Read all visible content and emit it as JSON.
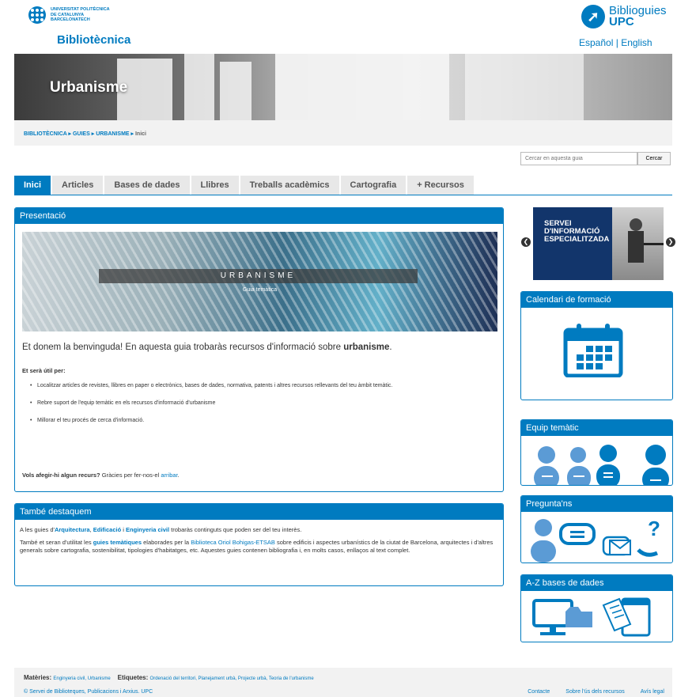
{
  "header": {
    "upc_lines": [
      "UNIVERSITAT POLITÈCNICA",
      "DE CATALUNYA",
      "BARCELONATECH"
    ],
    "upc_mark": "UPC",
    "site_title": "Bibliotècnica",
    "bibliog_brand": "Biblioguies",
    "bibliog_brand_bold": "UPC",
    "lang_es": "Español",
    "lang_sep": "|",
    "lang_en": "English"
  },
  "banner": {
    "title": "Urbanisme"
  },
  "breadcrumb": [
    "BIBLIOTÈCNICA",
    "GUIES",
    "URBANISME",
    "Inici"
  ],
  "search": {
    "placeholder": "Cercar en aquesta guia",
    "button": "Cercar"
  },
  "tabs": [
    "Inici",
    "Articles",
    "Bases de dades",
    "Llibres",
    "Treballs acadèmics",
    "Cartografia",
    "+ Recursos"
  ],
  "presentacio": {
    "heading": "Presentació",
    "hero_title": "URBANISME",
    "hero_sub": "Guia temàtica",
    "welcome": "Et donem la benvinguda! En aquesta guia trobaràs recursos d'informació sobre",
    "welcome_bold": "urbanisme",
    "welcome_end": ".",
    "useful_heading": "Et serà útil per:",
    "useful": [
      "Localitzar articles de revistes, llibres en paper o electrònics, bases de dades, normativa, patents i altres recursos rellevants del teu àmbit temàtic.",
      "Rebre suport de l'equip temàtic en els recursos d'informació d'urbanisme",
      "Millorar el teu procés de cerca d'informació."
    ],
    "add_bold": "Vols afegir-hi algun recurs?",
    "add_text": "Gràcies per fer-nos-el",
    "add_link": "arribar",
    "add_end": "."
  },
  "destaquem": {
    "heading": "També destaquem",
    "p1_a": "A les guies d'",
    "p1_l1": "Arquitectura",
    "p1_sep1": ",",
    "p1_l2": "Edificació",
    "p1_sep2": "i",
    "p1_l3": "Enginyeria civil",
    "p1_b": "trobaràs continguts que poden ser del teu interès.",
    "p2_a": "També et seran d'utilitat les",
    "p2_l1": "guies temàtiques",
    "p2_b": "elaborades per la",
    "p2_l2": "Biblioteca Oriol Bohigas-ETSAB",
    "p2_c": "sobre edificis i aspectes urbanístics de la ciutat de Barcelona, arquitectes i d'altres generals sobre cartografia, sostenibilitat, tipologies d'habitatges, etc. Aquestes guies contenen bibliografia i, en molts casos, enllaços al text complet."
  },
  "sidebar": {
    "promo_title": "SERVEI D'INFORMACIÓ ESPECIALITZADA",
    "calendar": "Calendari de formació",
    "team": "Equip temàtic",
    "ask": "Pregunta'ns",
    "az": "A-Z bases de dades"
  },
  "footer": {
    "materies_label": "Matèries:",
    "materies": "Enginyeria civil, Urbanisme",
    "etiquetes_label": "Etiquetes:",
    "etiquetes": "Ordenació del territori, Planejament urbà, Projecte urbà, Teoria de l'urbanisme",
    "copyright": "© Servei de Biblioteques, Publicacions i Arxius. UPC",
    "links": [
      "Contacte",
      "Sobre l'ús dels recursos",
      "Avís legal"
    ]
  },
  "colors": {
    "accent": "#007bc0",
    "promo": "#12356b"
  }
}
